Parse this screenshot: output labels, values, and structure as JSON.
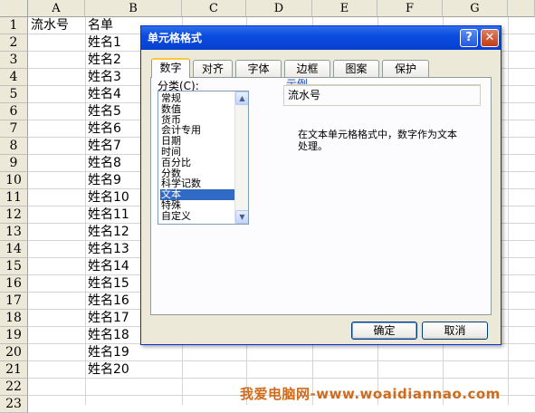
{
  "sheet": {
    "columns": [
      "A",
      "B",
      "C",
      "D",
      "E",
      "F",
      "G"
    ],
    "rows": [
      "1",
      "2",
      "3",
      "4",
      "5",
      "6",
      "7",
      "8",
      "9",
      "10",
      "11",
      "12",
      "13",
      "14",
      "15",
      "16",
      "17",
      "18",
      "19",
      "20",
      "21",
      "22",
      "23"
    ],
    "a1": "流水号",
    "b_column": [
      "名单",
      "姓名1",
      "姓名2",
      "姓名3",
      "姓名4",
      "姓名5",
      "姓名6",
      "姓名7",
      "姓名8",
      "姓名9",
      "姓名10",
      "姓名11",
      "姓名12",
      "姓名13",
      "姓名14",
      "姓名15",
      "姓名16",
      "姓名17",
      "姓名18",
      "姓名19",
      "姓名20"
    ]
  },
  "dialog": {
    "title": "单元格格式",
    "help_label": "?",
    "close_label": "✕",
    "tabs": [
      "数字",
      "对齐",
      "字体",
      "边框",
      "图案",
      "保护"
    ],
    "active_tab": 0,
    "category_label": "分类(C):",
    "categories": [
      "常规",
      "数值",
      "货币",
      "会计专用",
      "日期",
      "时间",
      "百分比",
      "分数",
      "科学记数",
      "文本",
      "特殊",
      "自定义"
    ],
    "selected_category": 9,
    "sample_label": "示例",
    "sample_value": "流水号",
    "description": "在文本单元格格式中，数字作为文本处理。",
    "ok_label": "确定",
    "cancel_label": "取消"
  },
  "watermark": "我爱电脑网-www.woaidiannao.com",
  "colors": {
    "title_bar": "#0a4ce0",
    "selection": "#316ac5",
    "header_bg": "#ece9d8",
    "watermark": "#d06b1c"
  }
}
